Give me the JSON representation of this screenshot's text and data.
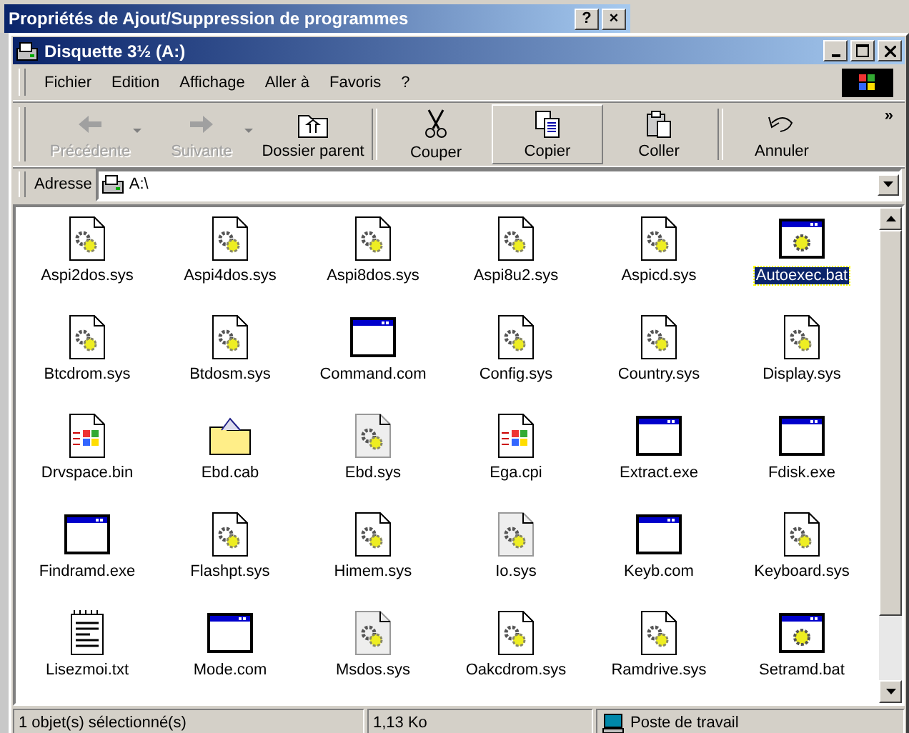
{
  "dialog": {
    "title": "Propriétés de Ajout/Suppression de programmes",
    "buttons": [
      "?",
      "×"
    ]
  },
  "window": {
    "title": "Disquette 3½ (A:)",
    "controls": [
      {
        "kind": "minimize"
      },
      {
        "kind": "maximize"
      },
      {
        "kind": "close"
      }
    ]
  },
  "menu": [
    "Fichier",
    "Edition",
    "Affichage",
    "Aller à",
    "Favoris",
    "?"
  ],
  "toolbar": [
    {
      "label": "Précédente",
      "kind": "back",
      "disabled": true,
      "dropdown": true,
      "hot": false
    },
    {
      "label": "Suivante",
      "kind": "forward",
      "disabled": true,
      "dropdown": true,
      "hot": false
    },
    {
      "label": "Dossier parent",
      "kind": "up",
      "disabled": false,
      "dropdown": false,
      "hot": false
    },
    {
      "label": "Couper",
      "kind": "cut",
      "disabled": false,
      "dropdown": false,
      "hot": false
    },
    {
      "label": "Copier",
      "kind": "copy",
      "disabled": false,
      "dropdown": false,
      "hot": true
    },
    {
      "label": "Coller",
      "kind": "paste",
      "disabled": false,
      "dropdown": false,
      "hot": false
    },
    {
      "label": "Annuler",
      "kind": "undo",
      "disabled": false,
      "dropdown": false,
      "hot": false
    }
  ],
  "toolbar_more": "»",
  "address": {
    "label": "Adresse",
    "value": "A:\\"
  },
  "files": [
    {
      "name": "Aspi2dos.sys",
      "kind": "sys",
      "selected": false
    },
    {
      "name": "Aspi4dos.sys",
      "kind": "sys",
      "selected": false
    },
    {
      "name": "Aspi8dos.sys",
      "kind": "sys",
      "selected": false
    },
    {
      "name": "Aspi8u2.sys",
      "kind": "sys",
      "selected": false
    },
    {
      "name": "Aspicd.sys",
      "kind": "sys",
      "selected": false
    },
    {
      "name": "Autoexec.bat",
      "kind": "bat",
      "selected": true
    },
    {
      "name": "Btcdrom.sys",
      "kind": "sys",
      "selected": false
    },
    {
      "name": "Btdosm.sys",
      "kind": "sys",
      "selected": false
    },
    {
      "name": "Command.com",
      "kind": "exe",
      "selected": false
    },
    {
      "name": "Config.sys",
      "kind": "sys",
      "selected": false
    },
    {
      "name": "Country.sys",
      "kind": "sys",
      "selected": false
    },
    {
      "name": "Display.sys",
      "kind": "sys",
      "selected": false
    },
    {
      "name": "Drvspace.bin",
      "kind": "win",
      "selected": false
    },
    {
      "name": "Ebd.cab",
      "kind": "cab",
      "selected": false
    },
    {
      "name": "Ebd.sys",
      "kind": "hidden",
      "selected": false
    },
    {
      "name": "Ega.cpi",
      "kind": "win",
      "selected": false
    },
    {
      "name": "Extract.exe",
      "kind": "exe",
      "selected": false
    },
    {
      "name": "Fdisk.exe",
      "kind": "exe",
      "selected": false
    },
    {
      "name": "Findramd.exe",
      "kind": "exe",
      "selected": false
    },
    {
      "name": "Flashpt.sys",
      "kind": "sys",
      "selected": false
    },
    {
      "name": "Himem.sys",
      "kind": "sys",
      "selected": false
    },
    {
      "name": "Io.sys",
      "kind": "hidden",
      "selected": false
    },
    {
      "name": "Keyb.com",
      "kind": "exe",
      "selected": false
    },
    {
      "name": "Keyboard.sys",
      "kind": "sys",
      "selected": false
    },
    {
      "name": "Lisezmoi.txt",
      "kind": "txt",
      "selected": false
    },
    {
      "name": "Mode.com",
      "kind": "exe",
      "selected": false
    },
    {
      "name": "Msdos.sys",
      "kind": "hidden",
      "selected": false
    },
    {
      "name": "Oakcdrom.sys",
      "kind": "sys",
      "selected": false
    },
    {
      "name": "Ramdrive.sys",
      "kind": "sys",
      "selected": false
    },
    {
      "name": "Setramd.bat",
      "kind": "bat",
      "selected": false
    }
  ],
  "status_bar": {
    "selection": "1 objet(s) sélectionné(s)",
    "size": "1,13 Ko",
    "zone": "Poste de travail"
  }
}
